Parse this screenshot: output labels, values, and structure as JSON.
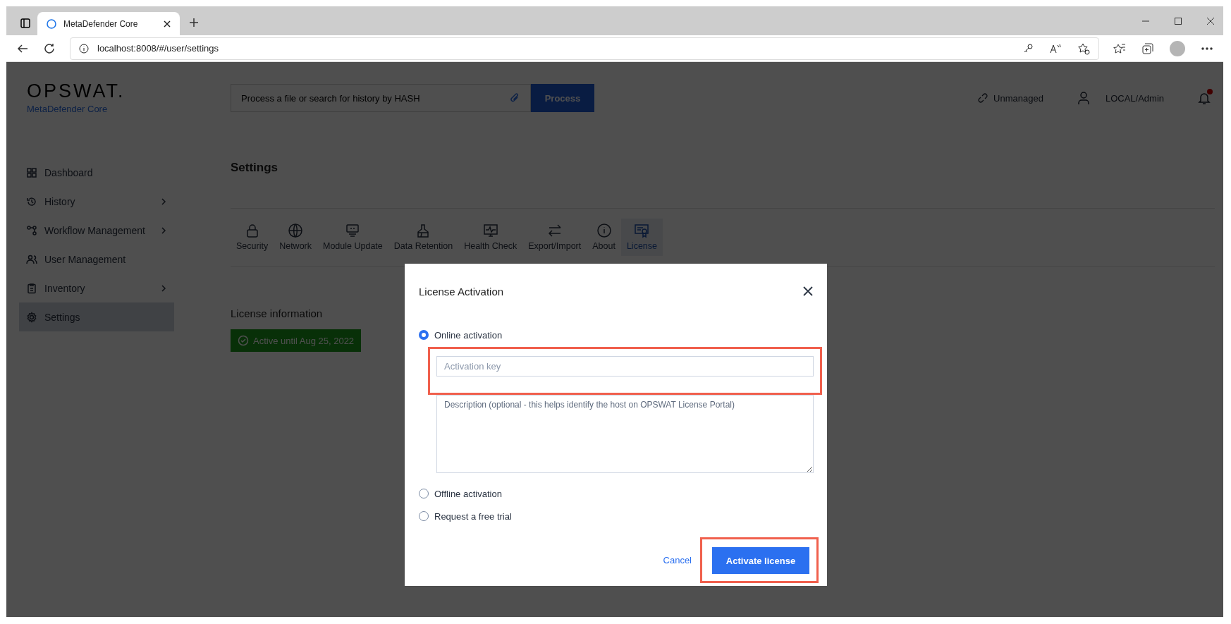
{
  "browser": {
    "tab_title": "MetaDefender Core",
    "url": "localhost:8008/#/user/settings"
  },
  "header": {
    "logo": "OPSWAT.",
    "product": "MetaDefender Core",
    "search_placeholder": "Process a file or search for history by HASH",
    "process_button": "Process",
    "management": "Unmanaged",
    "user": "LOCAL/Admin",
    "unread_notifications": true
  },
  "sidebar": {
    "items": [
      {
        "label": "Dashboard",
        "expandable": false,
        "selected": false
      },
      {
        "label": "History",
        "expandable": true,
        "selected": false
      },
      {
        "label": "Workflow Management",
        "expandable": true,
        "selected": false
      },
      {
        "label": "User Management",
        "expandable": false,
        "selected": false
      },
      {
        "label": "Inventory",
        "expandable": true,
        "selected": false
      },
      {
        "label": "Settings",
        "expandable": false,
        "selected": true
      }
    ]
  },
  "settings": {
    "title": "Settings",
    "tabs": [
      {
        "label": "Security",
        "selected": false
      },
      {
        "label": "Network",
        "selected": false
      },
      {
        "label": "Module Update",
        "selected": false
      },
      {
        "label": "Data Retention",
        "selected": false
      },
      {
        "label": "Health Check",
        "selected": false
      },
      {
        "label": "Export/Import",
        "selected": false
      },
      {
        "label": "About",
        "selected": false
      },
      {
        "label": "License",
        "selected": true
      }
    ],
    "license_heading": "License information",
    "license_status": {
      "kind": "active",
      "text": "Active until Aug 25, 2022"
    }
  },
  "dialog": {
    "title": "License Activation",
    "options": [
      {
        "label": "Online activation",
        "selected": true
      },
      {
        "label": "Offline activation",
        "selected": false
      },
      {
        "label": "Request a free trial",
        "selected": false
      }
    ],
    "key_placeholder": "Activation key",
    "key_highlighted": true,
    "description_placeholder": "Description (optional - this helps identify the host on OPSWAT License Portal)",
    "cancel": "Cancel",
    "activate": "Activate license",
    "activate_highlighted": true
  }
}
